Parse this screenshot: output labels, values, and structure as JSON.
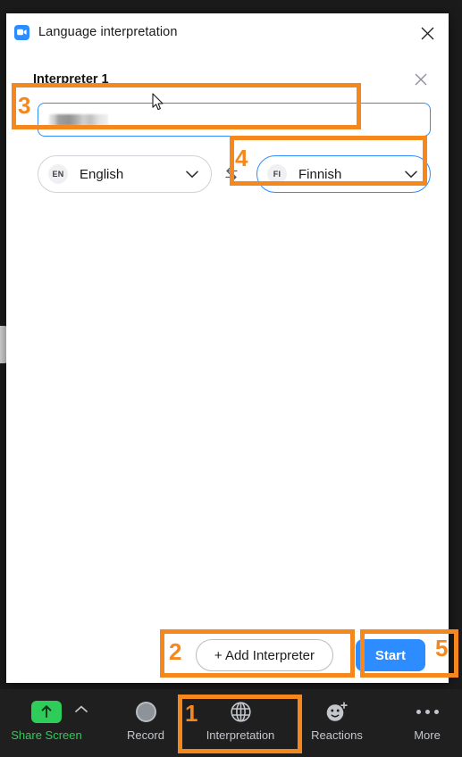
{
  "window": {
    "title": "Language interpretation",
    "logo_icon": "zoom-video-icon",
    "close_icon": "close-icon"
  },
  "interpreter": {
    "heading": "Interpreter 1",
    "remove_icon": "close-icon",
    "name_field": {
      "value": "",
      "placeholder": "",
      "redacted": true
    },
    "source_language": {
      "code": "EN",
      "label": "English",
      "chevron_icon": "chevron-down-icon"
    },
    "swap_icon": "swap-arrows-icon",
    "target_language": {
      "code": "FI",
      "label": "Finnish",
      "chevron_icon": "chevron-down-icon"
    }
  },
  "footer": {
    "add_interpreter_label": "+ Add Interpreter",
    "start_label": "Start"
  },
  "toolbar": {
    "items": [
      {
        "label": "Share Screen",
        "icon": "share-screen-icon"
      },
      {
        "label": "Record",
        "icon": "record-icon"
      },
      {
        "label": "Interpretation",
        "icon": "globe-icon"
      },
      {
        "label": "Reactions",
        "icon": "reactions-smiley-icon"
      },
      {
        "label": "More",
        "icon": "more-dots-icon"
      }
    ],
    "share_caret_icon": "chevron-up-icon"
  },
  "annotations": {
    "color": "#f5871f",
    "steps": [
      {
        "number": "1",
        "target": "Interpretation toolbar button"
      },
      {
        "number": "2",
        "target": "+ Add Interpreter button"
      },
      {
        "number": "3",
        "target": "Interpreter name field"
      },
      {
        "number": "4",
        "target": "Target language dropdown"
      },
      {
        "number": "5",
        "target": "Start button"
      }
    ]
  }
}
